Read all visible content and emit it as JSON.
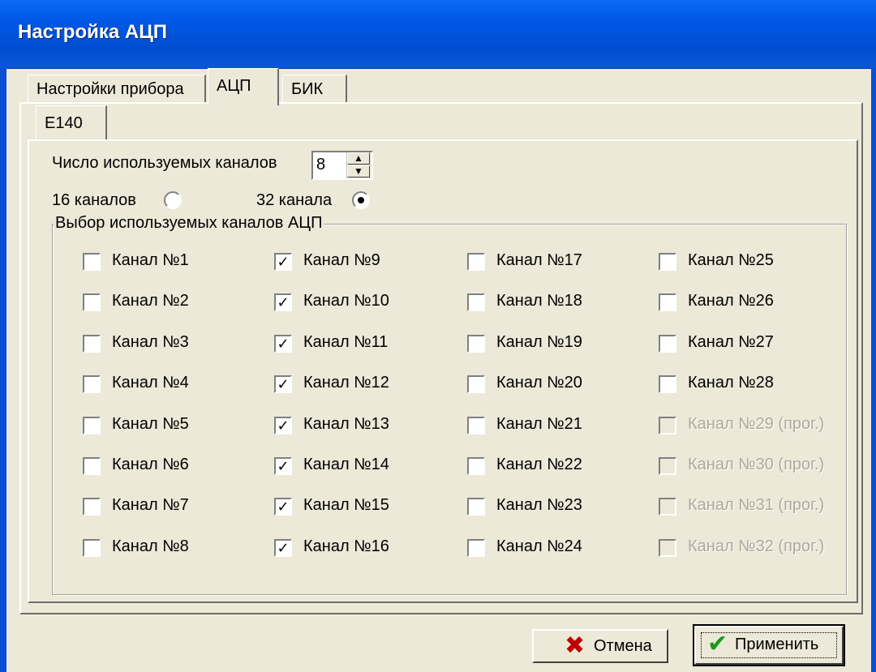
{
  "window": {
    "title": "Настройка АЦП"
  },
  "tabs": [
    "Настройки прибора",
    "АЦП",
    "БИК"
  ],
  "subtab": "E140",
  "channels_count": {
    "label": "Число используемых каналов",
    "value": "8"
  },
  "radios": [
    {
      "label": "16 каналов",
      "selected": false
    },
    {
      "label": "32 канала",
      "selected": true
    }
  ],
  "group_title": "Выбор используемых каналов АЦП",
  "channels": [
    {
      "label": "Канал №1",
      "checked": false,
      "enabled": true
    },
    {
      "label": "Канал №2",
      "checked": false,
      "enabled": true
    },
    {
      "label": "Канал №3",
      "checked": false,
      "enabled": true
    },
    {
      "label": "Канал №4",
      "checked": false,
      "enabled": true
    },
    {
      "label": "Канал №5",
      "checked": false,
      "enabled": true
    },
    {
      "label": "Канал №6",
      "checked": false,
      "enabled": true
    },
    {
      "label": "Канал №7",
      "checked": false,
      "enabled": true
    },
    {
      "label": "Канал №8",
      "checked": false,
      "enabled": true
    },
    {
      "label": "Канал №9",
      "checked": true,
      "enabled": true
    },
    {
      "label": "Канал №10",
      "checked": true,
      "enabled": true
    },
    {
      "label": "Канал №11",
      "checked": true,
      "enabled": true
    },
    {
      "label": "Канал №12",
      "checked": true,
      "enabled": true
    },
    {
      "label": "Канал №13",
      "checked": true,
      "enabled": true
    },
    {
      "label": "Канал №14",
      "checked": true,
      "enabled": true
    },
    {
      "label": "Канал №15",
      "checked": true,
      "enabled": true
    },
    {
      "label": "Канал №16",
      "checked": true,
      "enabled": true
    },
    {
      "label": "Канал №17",
      "checked": false,
      "enabled": true
    },
    {
      "label": "Канал №18",
      "checked": false,
      "enabled": true
    },
    {
      "label": "Канал №19",
      "checked": false,
      "enabled": true
    },
    {
      "label": "Канал №20",
      "checked": false,
      "enabled": true
    },
    {
      "label": "Канал №21",
      "checked": false,
      "enabled": true
    },
    {
      "label": "Канал №22",
      "checked": false,
      "enabled": true
    },
    {
      "label": "Канал №23",
      "checked": false,
      "enabled": true
    },
    {
      "label": "Канал №24",
      "checked": false,
      "enabled": true
    },
    {
      "label": "Канал №25",
      "checked": false,
      "enabled": true
    },
    {
      "label": "Канал №26",
      "checked": false,
      "enabled": true
    },
    {
      "label": "Канал №27",
      "checked": false,
      "enabled": true
    },
    {
      "label": "Канал №28",
      "checked": false,
      "enabled": true
    },
    {
      "label": "Канал №29 (прог.)",
      "checked": false,
      "enabled": false
    },
    {
      "label": "Канал №30 (прог.)",
      "checked": false,
      "enabled": false
    },
    {
      "label": "Канал №31 (прог.)",
      "checked": false,
      "enabled": false
    },
    {
      "label": "Канал №32 (прог.)",
      "checked": false,
      "enabled": false
    }
  ],
  "buttons": {
    "cancel": "Отмена",
    "apply": "Применить"
  },
  "icons": {
    "cancel": "red-x-icon",
    "apply": "green-check-icon"
  }
}
